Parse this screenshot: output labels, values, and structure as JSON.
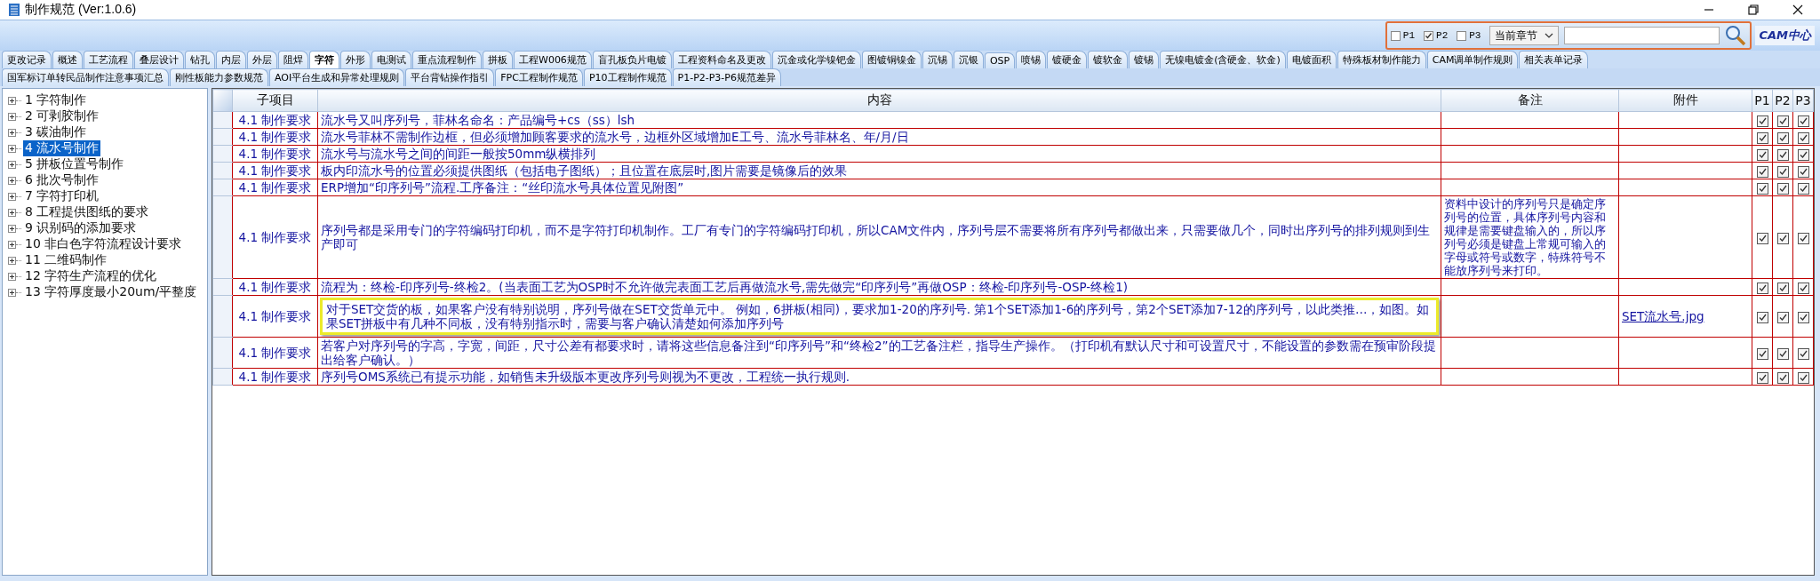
{
  "window": {
    "title": "制作规范 (Ver:1.0.6)"
  },
  "filter": {
    "options": [
      {
        "label": "P1",
        "checked": false
      },
      {
        "label": "P2",
        "checked": true
      },
      {
        "label": "P3",
        "checked": false
      }
    ],
    "scope": "当前章节",
    "logo": "CAM中心"
  },
  "tab_rows": [
    [
      {
        "label": "更改记录",
        "selected": false
      },
      {
        "label": "概述",
        "selected": false
      },
      {
        "label": "工艺流程",
        "selected": false
      },
      {
        "label": "叠层设计",
        "selected": false
      },
      {
        "label": "钻孔",
        "selected": false
      },
      {
        "label": "内层",
        "selected": false
      },
      {
        "label": "外层",
        "selected": false
      },
      {
        "label": "阻焊",
        "selected": false
      },
      {
        "label": "字符",
        "selected": true
      },
      {
        "label": "外形",
        "selected": false
      },
      {
        "label": "电测试",
        "selected": false
      },
      {
        "label": "重点流程制作",
        "selected": false
      },
      {
        "label": "拼板",
        "selected": false
      },
      {
        "label": "工程W006规范",
        "selected": false
      },
      {
        "label": "盲孔板负片电镀",
        "selected": false
      },
      {
        "label": "工程资料命名及更改",
        "selected": false
      },
      {
        "label": "沉金或化学镍钯金",
        "selected": false
      },
      {
        "label": "图镀铜镍金",
        "selected": false
      },
      {
        "label": "沉锡",
        "selected": false
      },
      {
        "label": "沉银",
        "selected": false
      },
      {
        "label": "OSP",
        "selected": false
      },
      {
        "label": "喷锡",
        "selected": false
      },
      {
        "label": "镀硬金",
        "selected": false
      },
      {
        "label": "镀软金",
        "selected": false
      },
      {
        "label": "镀锡",
        "selected": false
      },
      {
        "label": "无镍电镀金(含硬金、软金)",
        "selected": false
      },
      {
        "label": "电镀面积",
        "selected": false
      },
      {
        "label": "特殊板材制作能力",
        "selected": false
      },
      {
        "label": "CAM调单制作规则",
        "selected": false
      },
      {
        "label": "相关表单记录",
        "selected": false
      }
    ],
    [
      {
        "label": "国军标订单转民品制作注意事项汇总",
        "selected": false
      },
      {
        "label": "刚性板能力参数规范",
        "selected": false
      },
      {
        "label": "AOI平台生成和异常处理规则",
        "selected": false
      },
      {
        "label": "平台背钻操作指引",
        "selected": false
      },
      {
        "label": "FPC工程制作规范",
        "selected": false
      },
      {
        "label": "P10工程制作规范",
        "selected": false
      },
      {
        "label": "P1-P2-P3-P6规范差异",
        "selected": false
      }
    ]
  ],
  "tree": [
    {
      "label": "1 字符制作",
      "selected": false
    },
    {
      "label": "2 可剥胶制作",
      "selected": false
    },
    {
      "label": "3 碳油制作",
      "selected": false
    },
    {
      "label": "4 流水号制作",
      "selected": true
    },
    {
      "label": "5 拼板位置号制作",
      "selected": false
    },
    {
      "label": "6 批次号制作",
      "selected": false
    },
    {
      "label": "7 字符打印机",
      "selected": false
    },
    {
      "label": "8 工程提供图纸的要求",
      "selected": false
    },
    {
      "label": "9 识别码的添加要求",
      "selected": false
    },
    {
      "label": "10 非白色字符流程设计要求",
      "selected": false
    },
    {
      "label": "11 二维码制作",
      "selected": false
    },
    {
      "label": "12 字符生产流程的优化",
      "selected": false
    },
    {
      "label": "13 字符厚度最小20um/平整度",
      "selected": false
    }
  ],
  "table": {
    "columns": [
      "子项目",
      "内容",
      "备注",
      "附件",
      "P1",
      "P2",
      "P3"
    ],
    "rows": [
      {
        "item": "4.1 制作要求",
        "content": "流水号又叫序列号，菲林名命名：产品编号+cs（ss）lsh",
        "highlighted": false,
        "p1": true,
        "p2": true,
        "p3": true
      },
      {
        "item": "4.1 制作要求",
        "content": "流水号菲林不需制作边框，但必须增加顾客要求的流水号，边框外区域增加E工号、流水号菲林名、年/月/日",
        "highlighted": false,
        "p1": true,
        "p2": true,
        "p3": true
      },
      {
        "item": "4.1 制作要求",
        "content": "流水号与流水号之间的间距一般按50mm纵横排列",
        "highlighted": false,
        "p1": true,
        "p2": true,
        "p3": true
      },
      {
        "item": "4.1 制作要求",
        "content": "板内印流水号的位置必须提供图纸（包括电子图纸）；且位置在底层时,图片需要是镜像后的效果",
        "highlighted": false,
        "p1": true,
        "p2": true,
        "p3": true
      },
      {
        "item": "4.1 制作要求",
        "content": "ERP增加“印序列号”流程.工序备注：“丝印流水号具体位置见附图”",
        "highlighted": false,
        "p1": true,
        "p2": true,
        "p3": true
      },
      {
        "item": "4.1 制作要求",
        "content": "序列号都是采用专门的字符编码打印机，而不是字符打印机制作。工厂有专门的字符编码打印机，所以CAM文件内，序列号层不需要将所有序列号都做出来，只需要做几个，同时出序列号的排列规则到生产即可",
        "note": "资料中设计的序列号只是确定序列号的位置，具体序列号内容和规律是需要键盘输入的，所以序列号必须是键盘上常规可输入的字母或符号或数字，特殊符号不能放序列号来打印。",
        "highlighted": false,
        "p1": true,
        "p2": true,
        "p3": true
      },
      {
        "item": "4.1 制作要求",
        "content": "流程为：终检-印序列号-终检2。(当表面工艺为OSP时不允许做完表面工艺后再做流水号,需先做完“印序列号”再做OSP：终检-印序列号-OSP-终检1)",
        "highlighted": false,
        "p1": true,
        "p2": true,
        "p3": true
      },
      {
        "item": "4.1 制作要求",
        "content": "对于SET交货的板，如果客户没有特别说明，序列号做在SET交货单元中。 例如，6拼板(相同)，要求加1-20的序列号. 第1个SET添加1-6的序列号，第2个SET添加7-12的序列号，以此类推…，如图。如果SET拼板中有几种不同板，没有特别指示时，需要与客户确认清楚如何添加序列号",
        "highlighted": true,
        "attachment": "SET流水号.jpg",
        "p1": true,
        "p2": true,
        "p3": true
      },
      {
        "item": "4.1 制作要求",
        "content": "若客户对序列号的字高，字宽，间距，尺寸公差有都要求时，请将这些信息备注到“印序列号”和“终检2”的工艺备注栏，指导生产操作。（打印机有默认尺寸和可设置尺寸，不能设置的参数需在预审阶段提出给客户确认。）",
        "highlighted": false,
        "p1": true,
        "p2": true,
        "p3": true
      },
      {
        "item": "4.1 制作要求",
        "content": "序列号OMS系统已有提示功能，如销售未升级版本更改序列号则视为不更改，工程统一执行规则.",
        "highlighted": false,
        "p1": true,
        "p2": true,
        "p3": true
      }
    ]
  }
}
